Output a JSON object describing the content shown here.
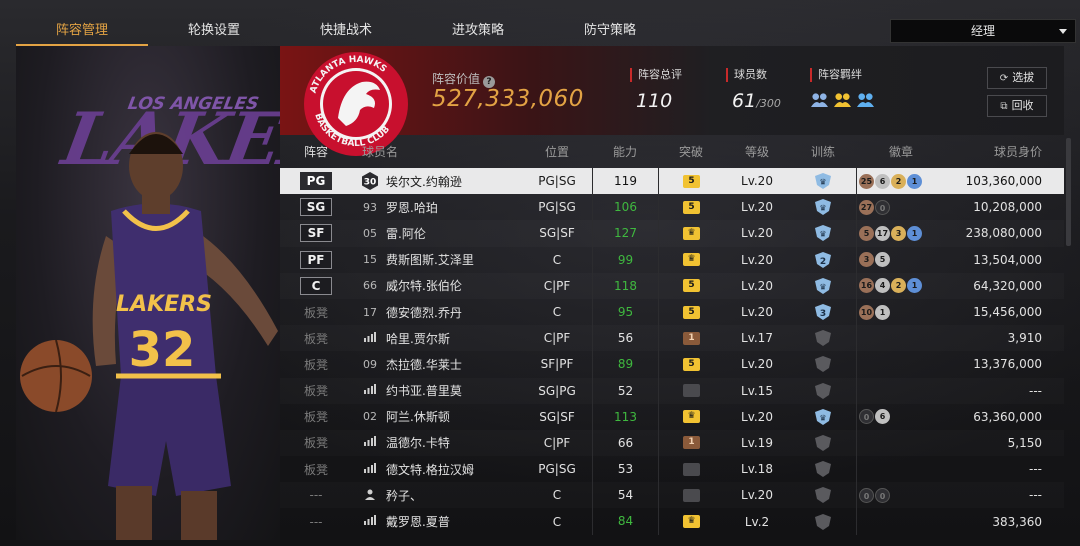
{
  "tabs": [
    {
      "label": "阵容管理",
      "active": true
    },
    {
      "label": "轮换设置",
      "active": false
    },
    {
      "label": "快捷战术",
      "active": false
    },
    {
      "label": "进攻策略",
      "active": false
    },
    {
      "label": "防守策略",
      "active": false
    }
  ],
  "manager_select": {
    "value": "经理"
  },
  "player_art": {
    "team_text": "LAKERS",
    "team_top": "LOS ANGELES",
    "jersey_number": "32",
    "jersey_name": "LAKERS"
  },
  "team": {
    "logo_ring_text": "ATLANTA HAWKS · BASKETBALL CLUB",
    "lineup_value_label": "阵容价值",
    "lineup_value": "527,333,060",
    "overall_label": "阵容总评",
    "overall": "110",
    "roster_label": "球员数",
    "roster_count": "61",
    "roster_max": "/300",
    "chemistry_label": "阵容羁绊",
    "colors": {
      "accent": "#e3a344",
      "red": "#c8102e",
      "green": "#3fb83f"
    }
  },
  "buttons": {
    "select": "选拔",
    "recall": "回收"
  },
  "columns": [
    "阵容",
    "球员名",
    "位置",
    "能力",
    "突破",
    "等级",
    "训练",
    "徽章",
    "球员身价"
  ],
  "rows": [
    {
      "slot": "PG",
      "bench": false,
      "num": "30",
      "icon": "hex",
      "name": "埃尔文.约翰逊",
      "pos": "PG|SG",
      "rating": "119",
      "green": false,
      "bk": "5",
      "bk_type": "gold",
      "lvl": "Lv.20",
      "train": "star",
      "badges": [
        [
          "25",
          "bronze"
        ],
        [
          "6",
          "silver"
        ],
        [
          "2",
          "gold"
        ],
        [
          "1",
          "blue"
        ]
      ],
      "value": "103,360,000",
      "selected": true
    },
    {
      "slot": "SG",
      "bench": false,
      "num": "93",
      "icon": "num",
      "name": "罗恩.哈珀",
      "pos": "PG|SG",
      "rating": "106",
      "green": true,
      "bk": "5",
      "bk_type": "gold",
      "lvl": "Lv.20",
      "train": "star",
      "badges": [
        [
          "27",
          "bronze"
        ],
        [
          "0",
          "dark"
        ]
      ],
      "value": "10,208,000"
    },
    {
      "slot": "SF",
      "bench": false,
      "num": "05",
      "icon": "num",
      "name": "雷.阿伦",
      "pos": "SG|SF",
      "rating": "127",
      "green": true,
      "bk": "♛",
      "bk_type": "gold",
      "lvl": "Lv.20",
      "train": "star",
      "badges": [
        [
          "5",
          "bronze"
        ],
        [
          "17",
          "silver"
        ],
        [
          "3",
          "gold"
        ],
        [
          "1",
          "blue"
        ]
      ],
      "value": "238,080,000"
    },
    {
      "slot": "PF",
      "bench": false,
      "num": "15",
      "icon": "num",
      "name": "费斯图斯.艾泽里",
      "pos": "C",
      "rating": "99",
      "green": true,
      "bk": "♛",
      "bk_type": "gold",
      "lvl": "Lv.20",
      "train": "2",
      "badges": [
        [
          "3",
          "bronze"
        ],
        [
          "5",
          "silver"
        ]
      ],
      "value": "13,504,000"
    },
    {
      "slot": "C",
      "bench": false,
      "num": "66",
      "icon": "num",
      "name": "威尔特.张伯伦",
      "pos": "C|PF",
      "rating": "118",
      "green": true,
      "bk": "5",
      "bk_type": "gold",
      "lvl": "Lv.20",
      "train": "star",
      "badges": [
        [
          "16",
          "bronze"
        ],
        [
          "4",
          "silver"
        ],
        [
          "2",
          "gold"
        ],
        [
          "1",
          "blue"
        ]
      ],
      "value": "64,320,000"
    },
    {
      "slot": "板凳",
      "bench": true,
      "num": "17",
      "icon": "num",
      "name": "德安德烈.乔丹",
      "pos": "C",
      "rating": "95",
      "green": true,
      "bk": "5",
      "bk_type": "gold",
      "lvl": "Lv.20",
      "train": "3",
      "badges": [
        [
          "10",
          "bronze"
        ],
        [
          "1",
          "silver"
        ]
      ],
      "value": "15,456,000"
    },
    {
      "slot": "板凳",
      "bench": true,
      "num": "",
      "icon": "bars",
      "name": "哈里.贾尔斯",
      "pos": "C|PF",
      "rating": "56",
      "green": false,
      "bk": "1",
      "bk_type": "bronze",
      "lvl": "Lv.17",
      "train": "gray",
      "badges": [],
      "value": "3,910"
    },
    {
      "slot": "板凳",
      "bench": true,
      "num": "09",
      "icon": "num",
      "name": "杰拉德.华莱士",
      "pos": "SF|PF",
      "rating": "89",
      "green": true,
      "bk": "5",
      "bk_type": "gold",
      "lvl": "Lv.20",
      "train": "gray",
      "badges": [],
      "value": "13,376,000"
    },
    {
      "slot": "板凳",
      "bench": true,
      "num": "",
      "icon": "bars",
      "name": "约书亚.普里莫",
      "pos": "SG|PG",
      "rating": "52",
      "green": false,
      "bk": "",
      "bk_type": "gray",
      "lvl": "Lv.15",
      "train": "gray",
      "badges": [],
      "value": "---"
    },
    {
      "slot": "板凳",
      "bench": true,
      "num": "02",
      "icon": "num",
      "name": "阿兰.休斯顿",
      "pos": "SG|SF",
      "rating": "113",
      "green": true,
      "bk": "♛",
      "bk_type": "gold",
      "lvl": "Lv.20",
      "train": "star",
      "badges": [
        [
          "0",
          "dark"
        ],
        [
          "6",
          "silver"
        ]
      ],
      "value": "63,360,000"
    },
    {
      "slot": "板凳",
      "bench": true,
      "num": "",
      "icon": "bars",
      "name": "温德尔.卡特",
      "pos": "C|PF",
      "rating": "66",
      "green": false,
      "bk": "1",
      "bk_type": "bronze",
      "lvl": "Lv.19",
      "train": "gray",
      "badges": [],
      "value": "5,150"
    },
    {
      "slot": "板凳",
      "bench": true,
      "num": "",
      "icon": "bars",
      "name": "德文特.格拉汉姆",
      "pos": "PG|SG",
      "rating": "53",
      "green": false,
      "bk": "",
      "bk_type": "gray",
      "lvl": "Lv.18",
      "train": "gray",
      "badges": [],
      "value": "---"
    },
    {
      "slot": "---",
      "bench": true,
      "num": "",
      "icon": "person",
      "name": "矜子、",
      "pos": "C",
      "rating": "54",
      "green": false,
      "bk": "",
      "bk_type": "gray",
      "lvl": "Lv.20",
      "train": "gray",
      "badges": [
        [
          "0",
          "dark"
        ],
        [
          "0",
          "dark"
        ]
      ],
      "value": "---"
    },
    {
      "slot": "---",
      "bench": true,
      "num": "",
      "icon": "bars",
      "name": "戴罗恩.夏普",
      "pos": "C",
      "rating": "84",
      "green": true,
      "bk": "♛",
      "bk_type": "gold",
      "lvl": "Lv.2",
      "train": "gray",
      "badges": [],
      "value": "383,360"
    }
  ]
}
